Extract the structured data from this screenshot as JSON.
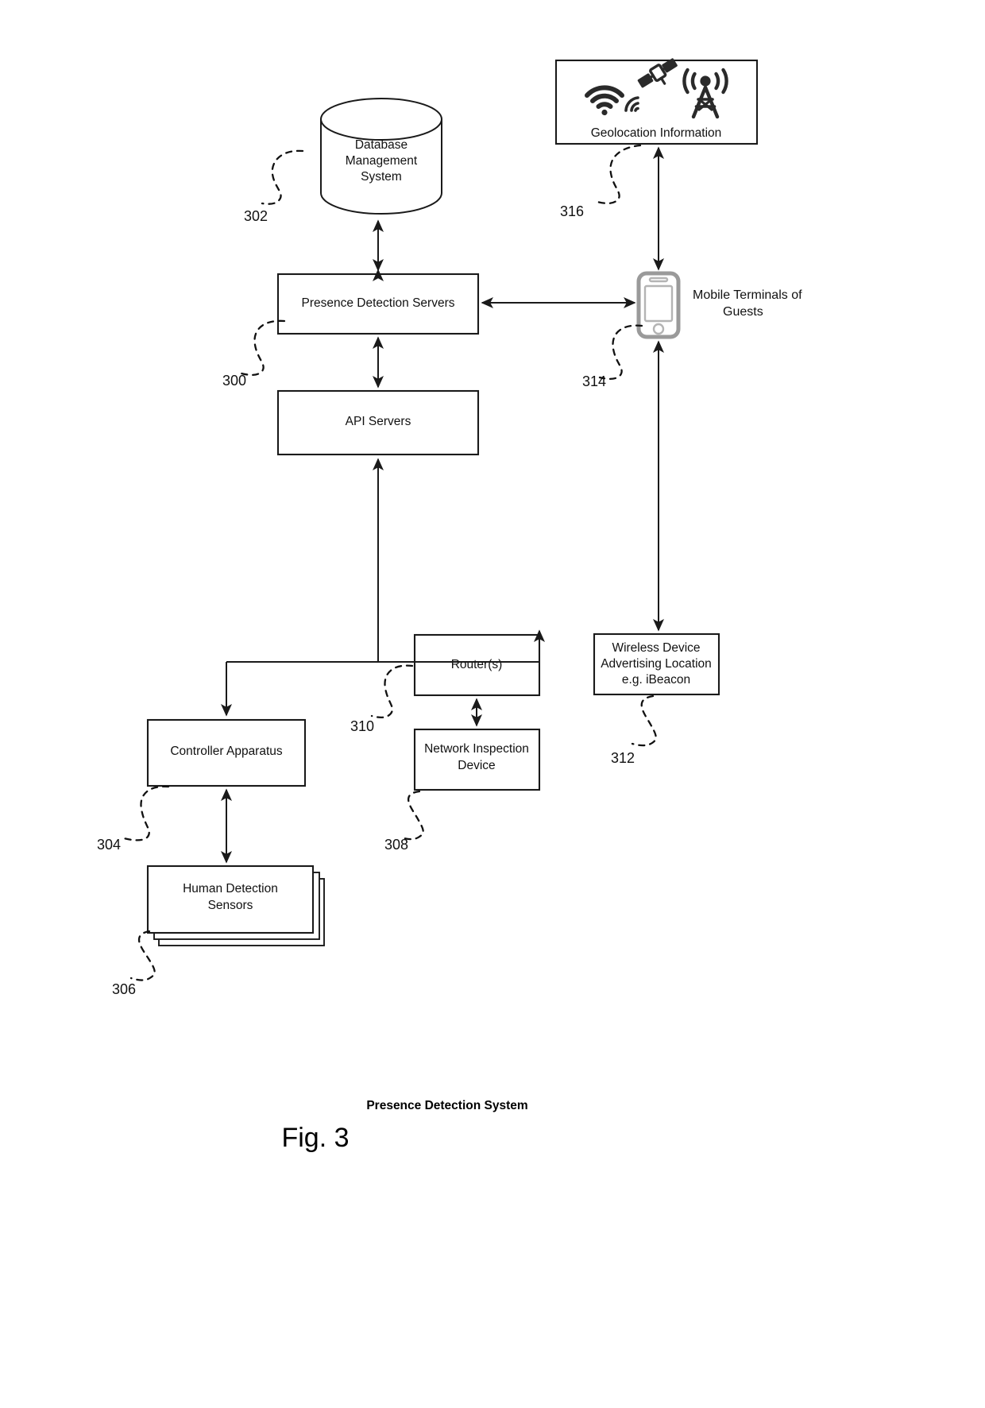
{
  "figure": {
    "caption": "Presence Detection System",
    "number_label": "Fig. 3"
  },
  "nodes": {
    "database": {
      "label_lines": [
        "Database",
        "Management",
        "System"
      ],
      "ref": "302",
      "shape": "cylinder"
    },
    "presence_servers": {
      "label_lines": [
        "Presence Detection Servers"
      ],
      "ref": "300",
      "shape": "rect"
    },
    "api_servers": {
      "label_lines": [
        "API Servers"
      ],
      "ref": "",
      "shape": "rect"
    },
    "controller": {
      "label_lines": [
        "Controller Apparatus"
      ],
      "ref": "304",
      "shape": "rect"
    },
    "sensors": {
      "label_lines": [
        "Human Detection",
        "Sensors"
      ],
      "ref": "306",
      "shape": "stacked-rect"
    },
    "routers": {
      "label_lines": [
        "Router(s)"
      ],
      "ref": "310",
      "shape": "rect"
    },
    "inspection": {
      "label_lines": [
        "Network Inspection",
        "Device"
      ],
      "ref": "308",
      "shape": "rect"
    },
    "beacon": {
      "label_lines": [
        "Wireless Device",
        "Advertising Location",
        "e.g. iBeacon"
      ],
      "ref": "312",
      "shape": "rect"
    },
    "geolocation": {
      "label_lines": [
        "Geolocation Information"
      ],
      "ref": "316",
      "shape": "rect",
      "icons": [
        "wifi-icon",
        "satellite-icon",
        "cell-tower-icon"
      ]
    },
    "mobile_terminals": {
      "label_lines": [
        "Mobile Terminals of",
        "Guests"
      ],
      "ref": "314",
      "shape": "phone"
    }
  },
  "colors": {
    "line": "#1a1a1a",
    "text": "#111111",
    "background": "#ffffff",
    "phone_outline": "#9a9a9a",
    "icon": "#2a2a2a"
  }
}
